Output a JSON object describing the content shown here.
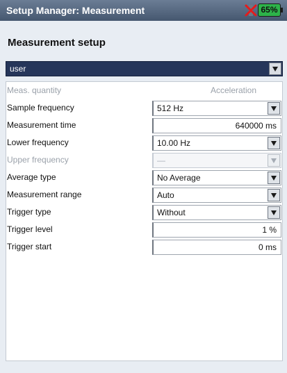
{
  "window": {
    "title": "Setup Manager: Measurement",
    "battery": "65%",
    "status_icon": "power-warning-icon"
  },
  "heading": "Measurement setup",
  "profile": {
    "selected": "user"
  },
  "form": {
    "meas_quantity": {
      "label": "Meas. quantity",
      "value": "Acceleration"
    },
    "sample_frequency": {
      "label": "Sample frequency",
      "value": "512 Hz"
    },
    "measurement_time": {
      "label": "Measurement time",
      "value": "640000 ms"
    },
    "lower_frequency": {
      "label": "Lower frequency",
      "value": "10.00 Hz"
    },
    "upper_frequency": {
      "label": "Upper frequency",
      "value": "—"
    },
    "average_type": {
      "label": "Average type",
      "value": "No Average"
    },
    "measurement_range": {
      "label": "Measurement range",
      "value": "Auto"
    },
    "trigger_type": {
      "label": "Trigger type",
      "value": "Without"
    },
    "trigger_level": {
      "label": "Trigger level",
      "value": "1 %"
    },
    "trigger_start": {
      "label": "Trigger start",
      "value": "0 ms"
    }
  },
  "colors": {
    "titlebar": "#45576f",
    "selection": "#26365a",
    "battery": "#2db34a"
  }
}
